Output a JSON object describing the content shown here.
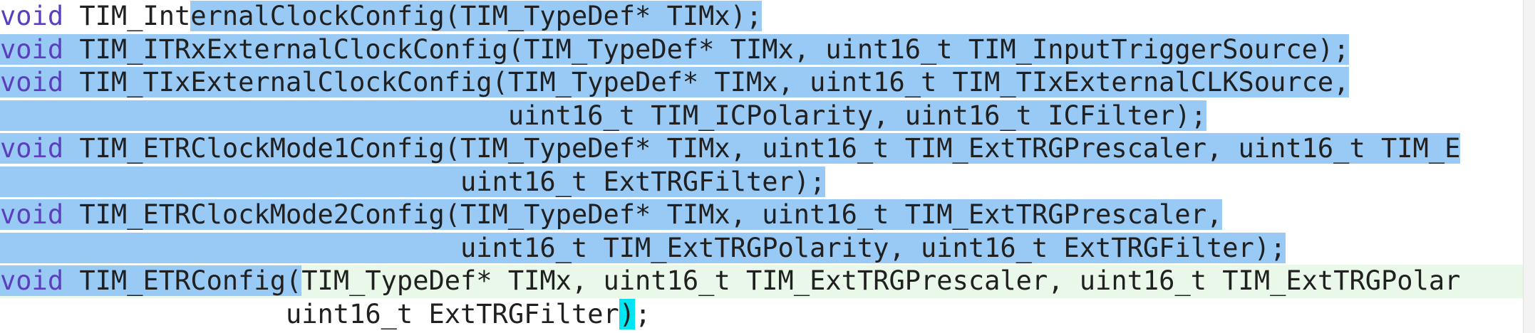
{
  "editor": {
    "lines": [
      {
        "kw": "void",
        "a": " TIM_Int",
        "b": "ernalClockConfig(TIM_TypeDef* TIMx);"
      },
      {
        "kw": "void",
        "a": " TIM_ITRxExternalClockConfig(TIM_TypeDef* TIMx, uint16_t TIM_InputTriggerSource);"
      },
      {
        "kw": "void",
        "a": " TIM_TIxExternalClockConfig(TIM_TypeDef* TIMx, uint16_t TIM_TIxExternalCLKSource,"
      },
      {
        "a": "                                uint16_t TIM_ICPolarity, uint16_t ICFilter);"
      },
      {
        "kw": "void",
        "a": " TIM_ETRClockMode1Config(TIM_TypeDef* TIMx, uint16_t TIM_ExtTRGPrescaler, uint16_t TIM_E"
      },
      {
        "a": "                             uint16_t ExtTRGFilter);"
      },
      {
        "kw": "void",
        "a": " TIM_ETRClockMode2Config(TIM_TypeDef* TIMx, uint16_t TIM_ExtTRGPrescaler,"
      },
      {
        "a": "                             uint16_t TIM_ExtTRGPolarity, uint16_t ExtTRGFilter);"
      },
      {
        "kw": "void",
        "a": " TIM_ETRConfig",
        "brace": "(",
        "b": "TIM_TypeDef* TIMx, uint16_t TIM_ExtTRGPrescaler, uint16_t TIM_ExtTRGPolar"
      },
      {
        "a": "                  uint16_t ExtTRGFilter",
        "brace": ")",
        "b": ";"
      }
    ]
  },
  "colors": {
    "selection": "#99c9f5",
    "current_line": "#e9f8e9",
    "keyword": "#5b3fbf",
    "brace_match": "#00e5f2"
  }
}
